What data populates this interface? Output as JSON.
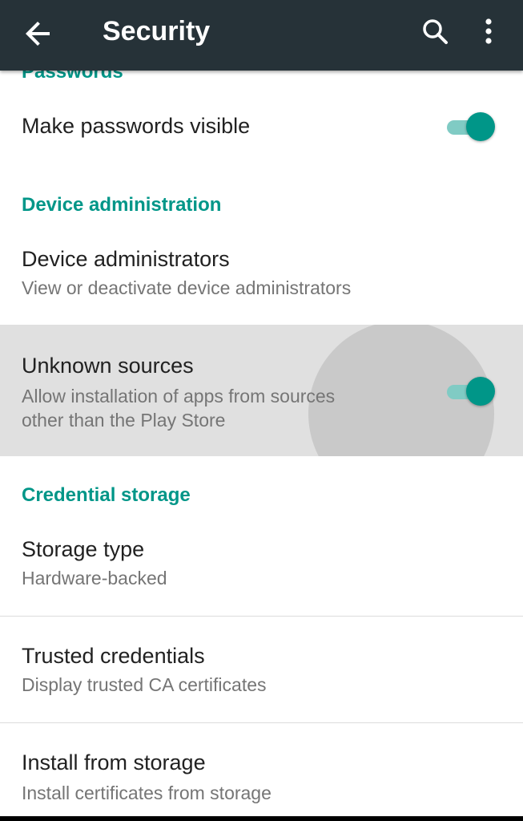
{
  "app_bar": {
    "title": "Security",
    "back_icon": "arrow-back-icon",
    "search_icon": "search-icon",
    "more_icon": "more-vert-icon",
    "background": "#263238"
  },
  "colors": {
    "accent": "#009688",
    "switch_track_on": "#80cbc4"
  },
  "sections": {
    "passwords": {
      "header": "Passwords",
      "make_passwords_visible": {
        "title": "Make passwords visible",
        "enabled": true
      }
    },
    "device_administration": {
      "header": "Device administration",
      "device_administrators": {
        "title": "Device administrators",
        "summary": "View or deactivate device administrators"
      },
      "unknown_sources": {
        "title": "Unknown sources",
        "summary_line1": "Allow installation of apps from sources",
        "summary_line2": "other than the Play Store",
        "enabled": true
      }
    },
    "credential_storage": {
      "header": "Credential storage",
      "storage_type": {
        "title": "Storage type",
        "summary": "Hardware-backed"
      },
      "trusted_credentials": {
        "title": "Trusted credentials",
        "summary": "Display trusted CA certificates"
      },
      "install_from_storage": {
        "title": "Install from storage",
        "summary": "Install certificates from storage"
      }
    }
  }
}
